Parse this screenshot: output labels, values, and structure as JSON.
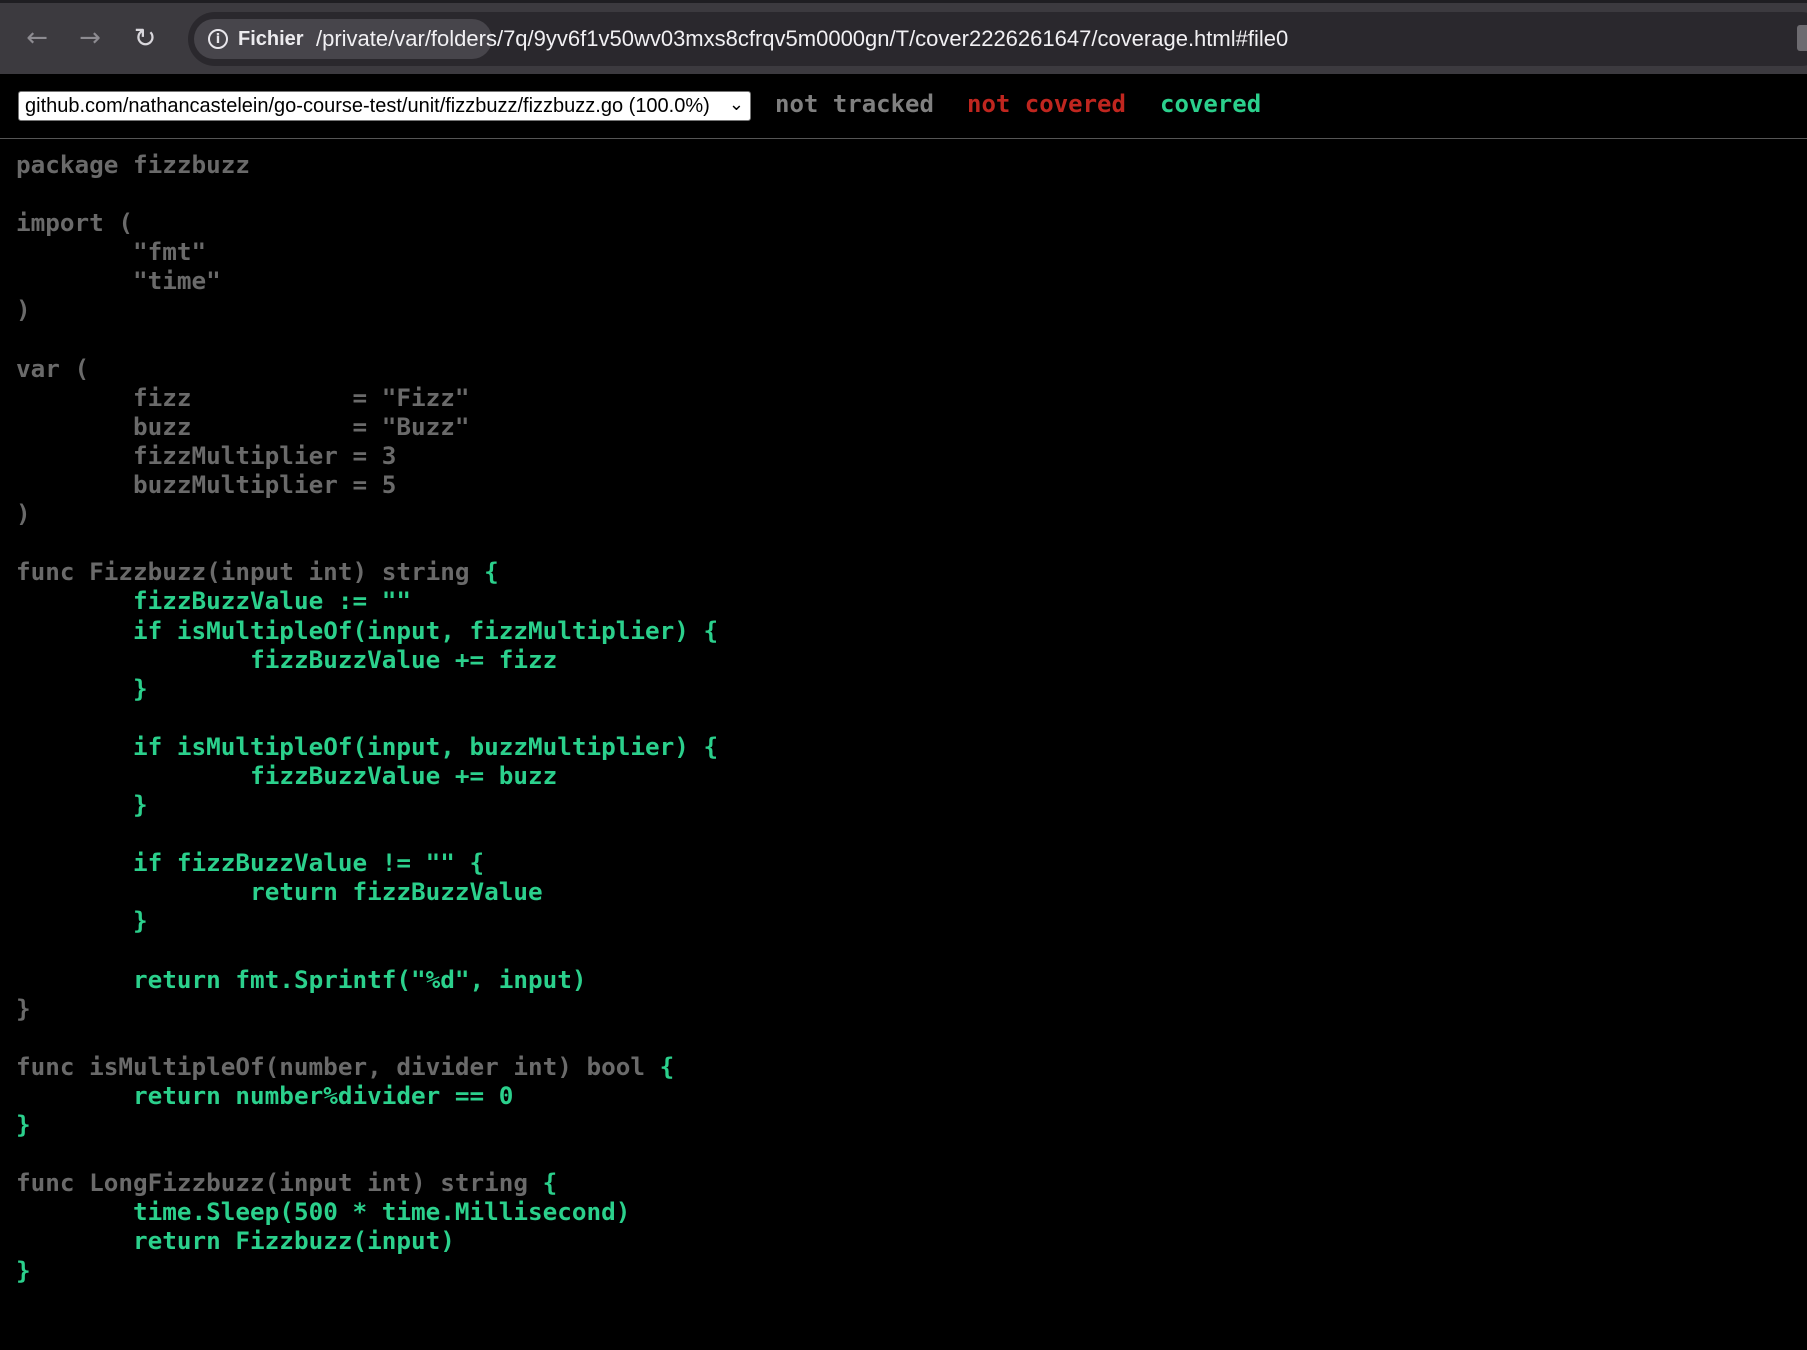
{
  "browser": {
    "back_icon": "arrow-left-icon",
    "forward_icon": "arrow-right-icon",
    "reload_icon": "reload-icon",
    "security_chip_label": "Fichier",
    "url": "/private/var/folders/7q/9yv6f1v50wv03mxs8cfrqv5m0000gn/T/cover2226261647/coverage.html#file0"
  },
  "coverage": {
    "file_select": "github.com/nathancastelein/go-course-test/unit/fizzbuzz/fizzbuzz.go (100.0%)",
    "legend": {
      "not_tracked": "not tracked",
      "not_covered": "not covered",
      "covered": "covered"
    },
    "colors": {
      "not_tracked": "#808080",
      "not_covered": "#c0261f",
      "covered": "#2bd08c"
    }
  },
  "code": {
    "s01": "package fizzbuzz\n\nimport (\n\t\"fmt\"\n\t\"time\"\n)\n\nvar (\n\tfizz           = \"Fizz\"\n\tbuzz           = \"Buzz\"\n\tfizzMultiplier = 3\n\tbuzzMultiplier = 5\n)\n\nfunc Fizzbuzz(input int) string ",
    "s02": "{\n\tfizzBuzzValue := \"\"\n\tif isMultipleOf(input, fizzMultiplier) {\n\t\tfizzBuzzValue += fizz\n\t}\n\n\tif isMultipleOf(input, buzzMultiplier) {\n\t\tfizzBuzzValue += buzz\n\t}\n\n\tif fizzBuzzValue != \"\" {\n\t\treturn fizzBuzzValue\n\t}\n\n\treturn fmt.Sprintf(\"%d\", input)",
    "s03": "\n}\n\nfunc isMultipleOf(number, divider int) bool ",
    "s04": "{\n\treturn number%divider == 0\n}",
    "s05": "\n\nfunc LongFizzbuzz(input int) string ",
    "s06": "{\n\ttime.Sleep(500 * time.Millisecond)\n\treturn Fizzbuzz(input)\n}"
  }
}
